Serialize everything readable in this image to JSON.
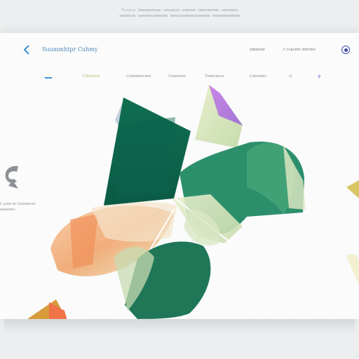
{
  "caption": {
    "line1": "Tucocu Ummmmummum ummumum ummmmm mmmummmmm umummmm",
    "line2": "ammmmum ummmmmummmmmm mmmuummmmmummmmmm mmmmmmmmmmmm"
  },
  "header": {
    "title": "Suummhtpr Cuhmy",
    "link_a": "umnenr",
    "link_b": "r ccacmc mrcmc"
  },
  "nav": {
    "tabs": [
      {
        "label": "Cllcicicu",
        "active": true
      },
      {
        "label": "Cnmmmcmu",
        "active": false
      },
      {
        "label": "Cnmnmy",
        "active": false
      },
      {
        "label": "Tmncmcu",
        "active": false
      },
      {
        "label": "Cmnmnr",
        "active": false
      },
      {
        "label": "rl",
        "active": false
      }
    ]
  },
  "side": {
    "line1": "L ynm rn Cnemncnt",
    "line2": "nmnnmc"
  },
  "icons": {
    "back": "chevron-left-icon",
    "next": "chevron-right-icon",
    "avatar": "user-avatar-icon",
    "side": "abstract-c-icon"
  },
  "colors": {
    "accent": "#3e8ed8",
    "title": "#4f86b7",
    "active_tab": "#b4b368",
    "avatar": "#3a4aa8"
  }
}
